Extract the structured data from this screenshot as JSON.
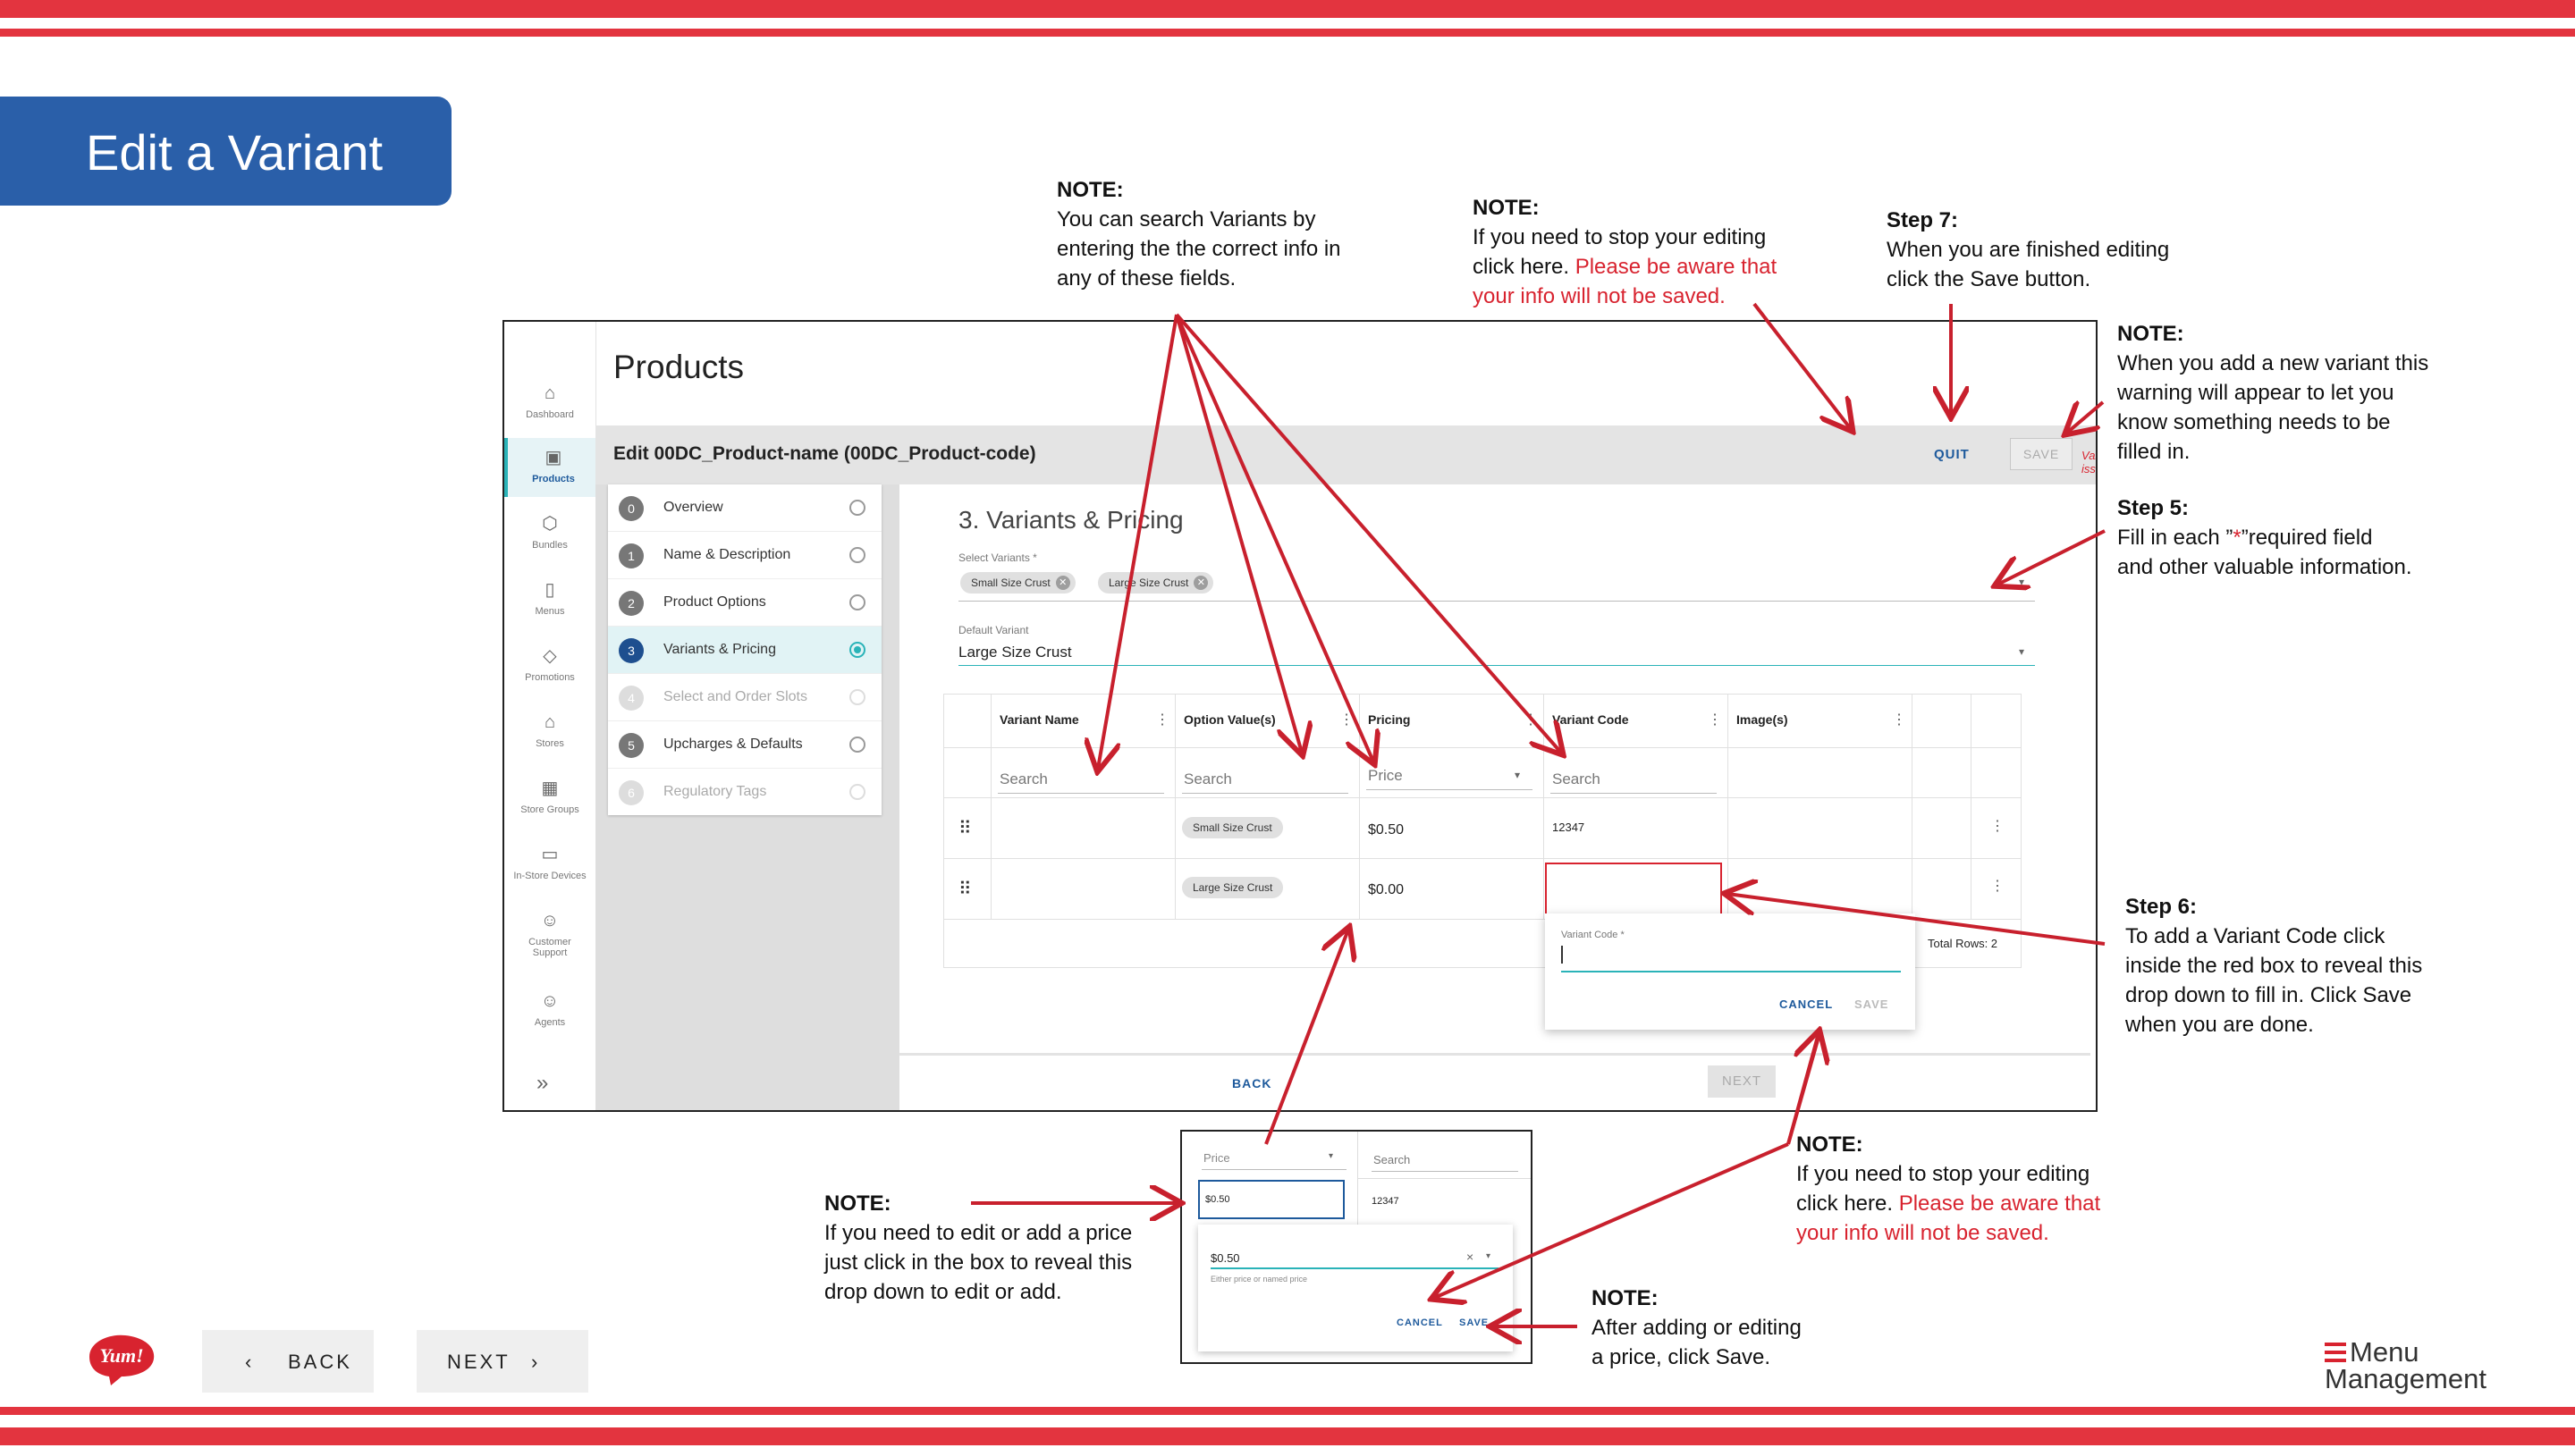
{
  "slide": {
    "title": "Edit a Variant",
    "back_label": "BACK",
    "next_label": "NEXT",
    "brand_logo": "Yum!",
    "product_logo_line1": "Menu",
    "product_logo_line2": "Management"
  },
  "notes": {
    "search": {
      "heading": "NOTE:",
      "lines": [
        "You can search Variants by",
        "entering the the correct info in",
        "any of these fields."
      ]
    },
    "quit_top": {
      "heading": "NOTE:",
      "line1": "If you need to stop your editing",
      "line2a": "click here.",
      "line2b": "Please be aware that",
      "line3": "your info will not be saved."
    },
    "step7": {
      "heading": "Step 7:",
      "line1": "When you are finished editing",
      "line2": "click the Save button."
    },
    "warning": {
      "heading": "NOTE:",
      "lines": [
        "When you add a new variant this",
        "warning will appear to let you",
        "know something needs to be",
        "filled in."
      ]
    },
    "step5": {
      "heading": "Step 5:",
      "line1a": "Fill in each ”",
      "star": "*",
      "line1b": "”required field",
      "line2": "and other valuable information."
    },
    "step6": {
      "heading": "Step 6:",
      "lines": [
        "To add a Variant Code click",
        "inside the red box to reveal this",
        "drop down to fill in. Click Save",
        "when you are done."
      ]
    },
    "price": {
      "heading": "NOTE:",
      "lines": [
        "If you need to edit or add a price",
        "just click in the box to reveal this",
        "drop down to edit or add."
      ]
    },
    "cancel_bottom": {
      "heading": "NOTE:",
      "line1": "If you need to stop your editing",
      "line2a": "click here.",
      "line2b": "Please be aware that",
      "line3": "your info will not be saved."
    },
    "save_price": {
      "heading": "NOTE:",
      "lines": [
        "After adding or editing",
        "a price, click Save."
      ]
    }
  },
  "app": {
    "nav": [
      {
        "label": "Dashboard",
        "icon": "home-icon",
        "glyph": "⌂"
      },
      {
        "label": "Products",
        "icon": "box-icon",
        "glyph": "▣"
      },
      {
        "label": "Bundles",
        "icon": "cube-icon",
        "glyph": "⬡"
      },
      {
        "label": "Menus",
        "icon": "document-icon",
        "glyph": "▯"
      },
      {
        "label": "Promotions",
        "icon": "tag-icon",
        "glyph": "◇"
      },
      {
        "label": "Stores",
        "icon": "store-icon",
        "glyph": "⌂"
      },
      {
        "label": "Store Groups",
        "icon": "grid-icon",
        "glyph": "▦"
      },
      {
        "label": "In-Store Devices",
        "icon": "monitor-icon",
        "glyph": "▭"
      },
      {
        "label": "Customer Support",
        "icon": "headset-icon",
        "glyph": "☺"
      },
      {
        "label": "Agents",
        "icon": "people-icon",
        "glyph": "☺"
      }
    ],
    "expand_glyph": "»",
    "page_title": "Products",
    "edit_title": "Edit 00DC_Product-name (00DC_Product-code)",
    "quit_label": "QUIT",
    "save_label": "SAVE",
    "validation_label": "Validation issues",
    "steps": [
      {
        "num": "0",
        "label": "Overview",
        "state": "normal"
      },
      {
        "num": "1",
        "label": "Name & Description",
        "state": "normal"
      },
      {
        "num": "2",
        "label": "Product Options",
        "state": "normal"
      },
      {
        "num": "3",
        "label": "Variants & Pricing",
        "state": "active"
      },
      {
        "num": "4",
        "label": "Select and Order Slots",
        "state": "disabled"
      },
      {
        "num": "5",
        "label": "Upcharges & Defaults",
        "state": "normal"
      },
      {
        "num": "6",
        "label": "Regulatory Tags",
        "state": "disabled"
      }
    ],
    "section_title": "3. Variants & Pricing",
    "select_variants_label": "Select Variants *",
    "selected_variants": [
      "Small Size Crust",
      "Large Size Crust"
    ],
    "default_variant_label": "Default Variant",
    "default_variant_value": "Large Size Crust",
    "columns": [
      "Variant Name",
      "Option Value(s)",
      "Pricing",
      "Variant Code",
      "Image(s)"
    ],
    "search_placeholder": "Search",
    "price_placeholder": "Price",
    "rows": [
      {
        "option": "Small Size Crust",
        "price": "$0.50",
        "code": "12347"
      },
      {
        "option": "Large Size Crust",
        "price": "$0.00",
        "code": ""
      }
    ],
    "total_rows": "Total Rows: 2",
    "variant_code_label": "Variant Code *",
    "cancel_label": "CANCEL",
    "popup_save_label": "SAVE",
    "back_label": "BACK",
    "next_label": "NEXT"
  },
  "inset": {
    "price_placeholder": "Price",
    "search_placeholder": "Search",
    "price_value": "$0.50",
    "code_value": "12347",
    "dropdown_value": "$0.50",
    "helper": "Either price or named price",
    "cancel_label": "CANCEL",
    "save_label": "SAVE"
  },
  "colors": {
    "accent_red": "#d8232f",
    "title_blue": "#2a5fa9",
    "teal": "#2ab3b8",
    "link_blue": "#1e5a9c"
  }
}
